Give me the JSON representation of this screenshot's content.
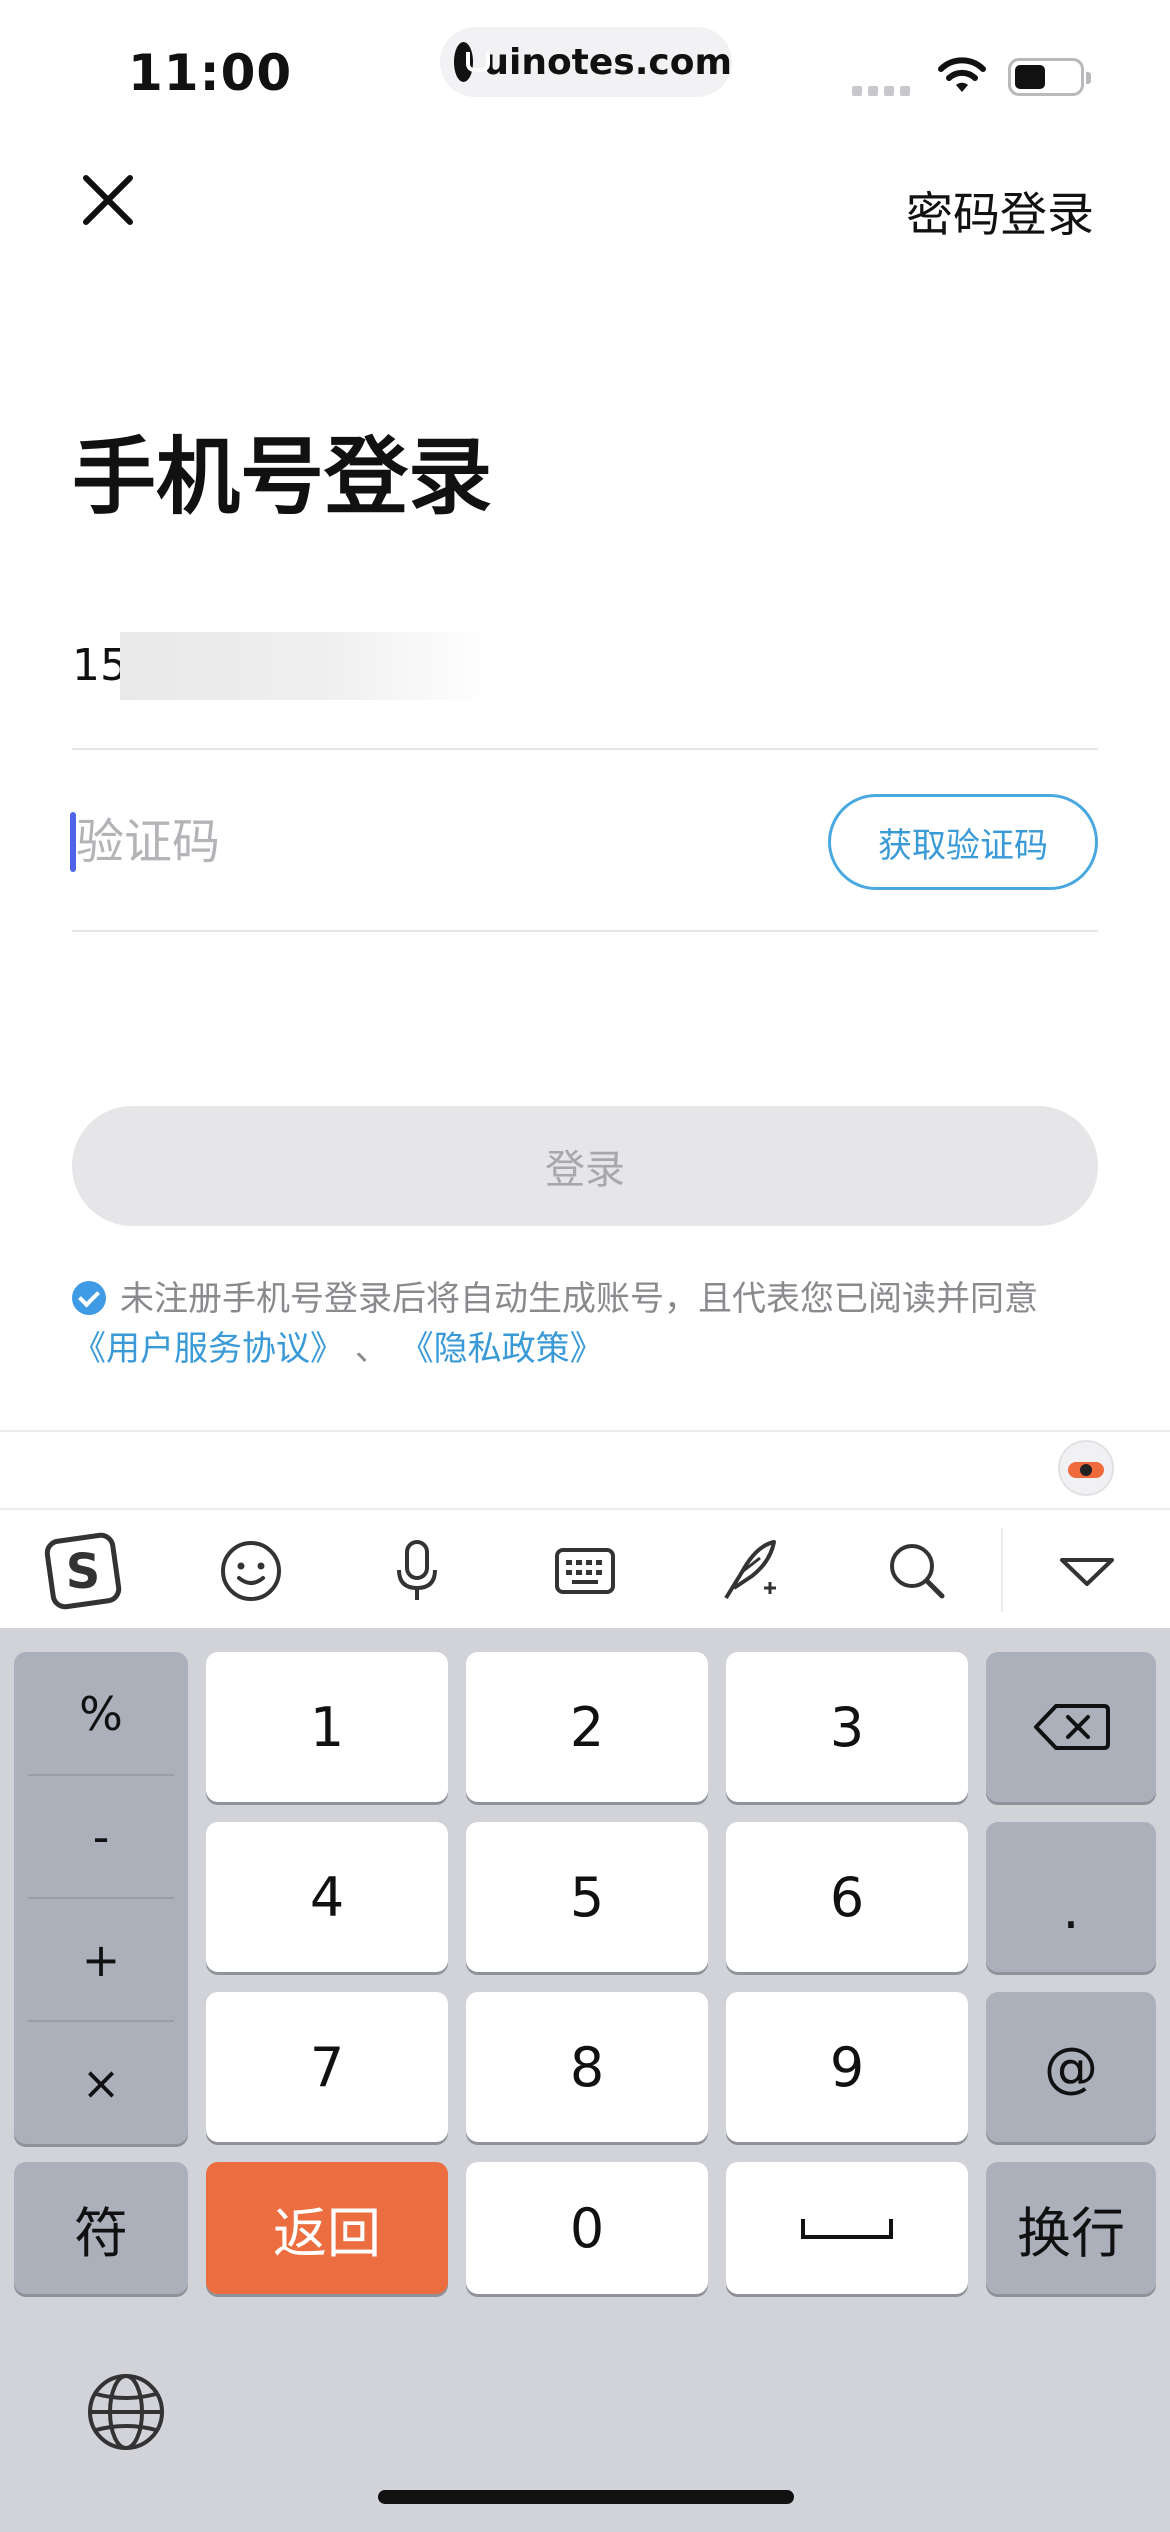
{
  "status_bar": {
    "time": "11:00",
    "url": "uinotes.com"
  },
  "nav": {
    "password_login": "密码登录"
  },
  "title": "手机号登录",
  "phone": {
    "value": "15"
  },
  "code": {
    "placeholder": "验证码",
    "get_code_label": "获取验证码"
  },
  "login_button": "登录",
  "agreement": {
    "text": "未注册手机号登录后将自动生成账号，且代表您已阅读并同意",
    "user_agreement": "《用户服务协议》",
    "separator": "、",
    "privacy_policy": "《隐私政策》"
  },
  "keyboard": {
    "symbols": [
      "%",
      "-",
      "+",
      "×"
    ],
    "digits": [
      "1",
      "2",
      "3",
      "4",
      "5",
      "6",
      "7",
      "8",
      "9",
      "0"
    ],
    "dot": ".",
    "at": "@",
    "symbol_key": "符",
    "back_key": "返回",
    "newline_key": "换行",
    "space_key": "␣",
    "accent_color": "#ec6e40"
  },
  "colors": {
    "link": "#3a9ad8",
    "cursor": "#4e63e8"
  }
}
